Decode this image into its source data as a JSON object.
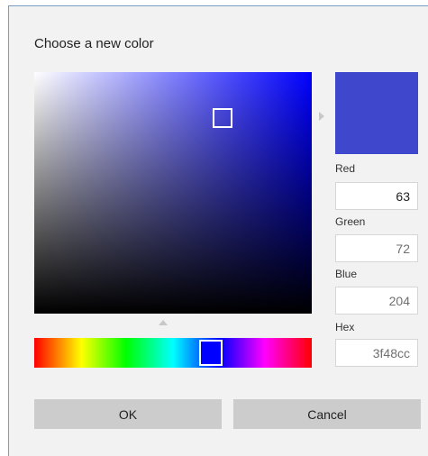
{
  "dialog": {
    "title": "Choose a new color"
  },
  "color": {
    "current_hex": "#3f48cc",
    "hue_hex": "#0000ff",
    "arrow_right_icon": "triangle-right-icon",
    "arrow_up_icon": "triangle-up-icon"
  },
  "fields": {
    "red": {
      "label": "Red",
      "value": "63"
    },
    "green": {
      "label": "Green",
      "value": "72"
    },
    "blue": {
      "label": "Blue",
      "value": "204"
    },
    "hex": {
      "label": "Hex",
      "value": "3f48cc"
    }
  },
  "buttons": {
    "ok_label": "OK",
    "cancel_label": "Cancel"
  }
}
